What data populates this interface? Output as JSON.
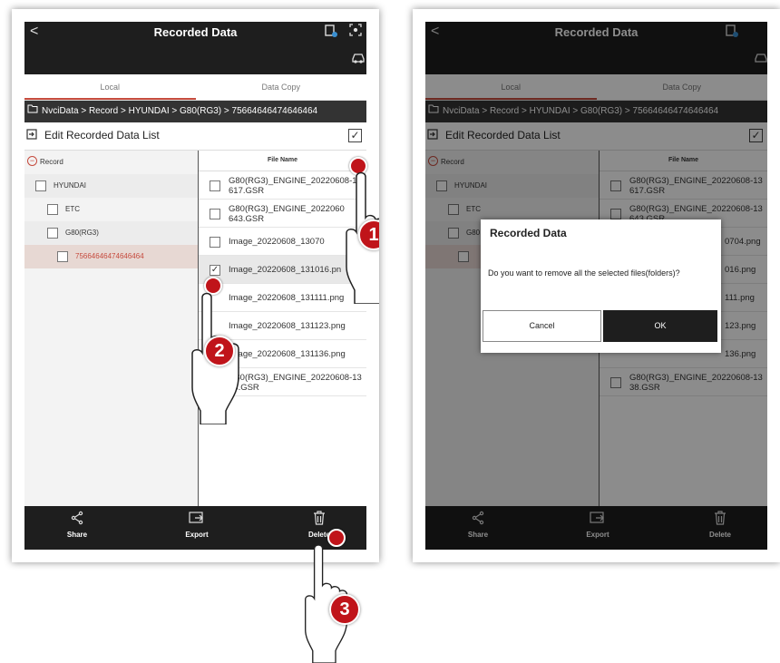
{
  "app": {
    "title": "Recorded Data",
    "back_glyph": "<",
    "title_icons": [
      "record-file-icon",
      "fullscreen-icon",
      "vehicle-icon"
    ]
  },
  "tabs": [
    {
      "label": "Local",
      "active": true
    },
    {
      "label": "Data Copy",
      "active": false
    }
  ],
  "breadcrumb": "NvciData > Record > HYUNDAI > G80(RG3) > 75664646474646464",
  "edit_bar": {
    "label": "Edit Recorded Data List",
    "select_all_checked": true
  },
  "tree": [
    {
      "label": "Record",
      "level": 0,
      "kind": "collapse"
    },
    {
      "label": "HYUNDAI",
      "level": 1,
      "kind": "checkbox"
    },
    {
      "label": "ETC",
      "level": 2,
      "kind": "checkbox"
    },
    {
      "label": "G80(RG3)",
      "level": 2,
      "kind": "checkbox"
    },
    {
      "label": "75664646474646464",
      "level": 3,
      "kind": "checkbox",
      "selected": true
    }
  ],
  "tree_right": [
    {
      "label": "Record"
    },
    {
      "label": "HYUNDAI"
    },
    {
      "label": "ETC"
    },
    {
      "label": "G80"
    },
    {
      "label": ""
    }
  ],
  "file_header": "File Name",
  "files_left": [
    {
      "name": "G80(RG3)_ENGINE_20220608-13\n617.GSR",
      "checked": false
    },
    {
      "name": "G80(RG3)_ENGINE_2022060\n643.GSR",
      "checked": false
    },
    {
      "name": "Image_20220608_13070",
      "checked": false
    },
    {
      "name": "Image_20220608_131016.pn",
      "checked": true
    },
    {
      "name": "Image_20220608_131111.png",
      "checked": false
    },
    {
      "name": "Image_20220608_131123.png",
      "checked": false
    },
    {
      "name": "Image_20220608_131136.png",
      "checked": false
    },
    {
      "name": "G80(RG3)_ENGINE_20220608-13\n38.GSR",
      "checked": false
    }
  ],
  "files_right": [
    {
      "name": "G80(RG3)_ENGINE_20220608-13\n617.GSR",
      "checked": false
    },
    {
      "name": "G80(RG3)_ENGINE_20220608-13\n643.GSR",
      "checked": false
    },
    {
      "name": "0704.png",
      "checked": false
    },
    {
      "name": "016.png",
      "checked": false
    },
    {
      "name": "111.png",
      "checked": false
    },
    {
      "name": "123.png",
      "checked": false
    },
    {
      "name": "136.png",
      "checked": false
    },
    {
      "name": "G80(RG3)_ENGINE_20220608-13\n38.GSR",
      "checked": false
    }
  ],
  "bottom_bar": [
    {
      "label": "Share",
      "icon": "share-icon"
    },
    {
      "label": "Export",
      "icon": "export-icon"
    },
    {
      "label": "Delete",
      "icon": "trash-icon"
    }
  ],
  "dialog": {
    "title": "Recorded Data",
    "message": "Do you want to remove all the selected files(folders)?",
    "cancel_label": "Cancel",
    "ok_label": "OK"
  },
  "step_badges": [
    "1",
    "2",
    "3"
  ],
  "colors": {
    "accent": "#c64b3e",
    "bar": "#1e1e1e",
    "marker": "#c0141a"
  }
}
